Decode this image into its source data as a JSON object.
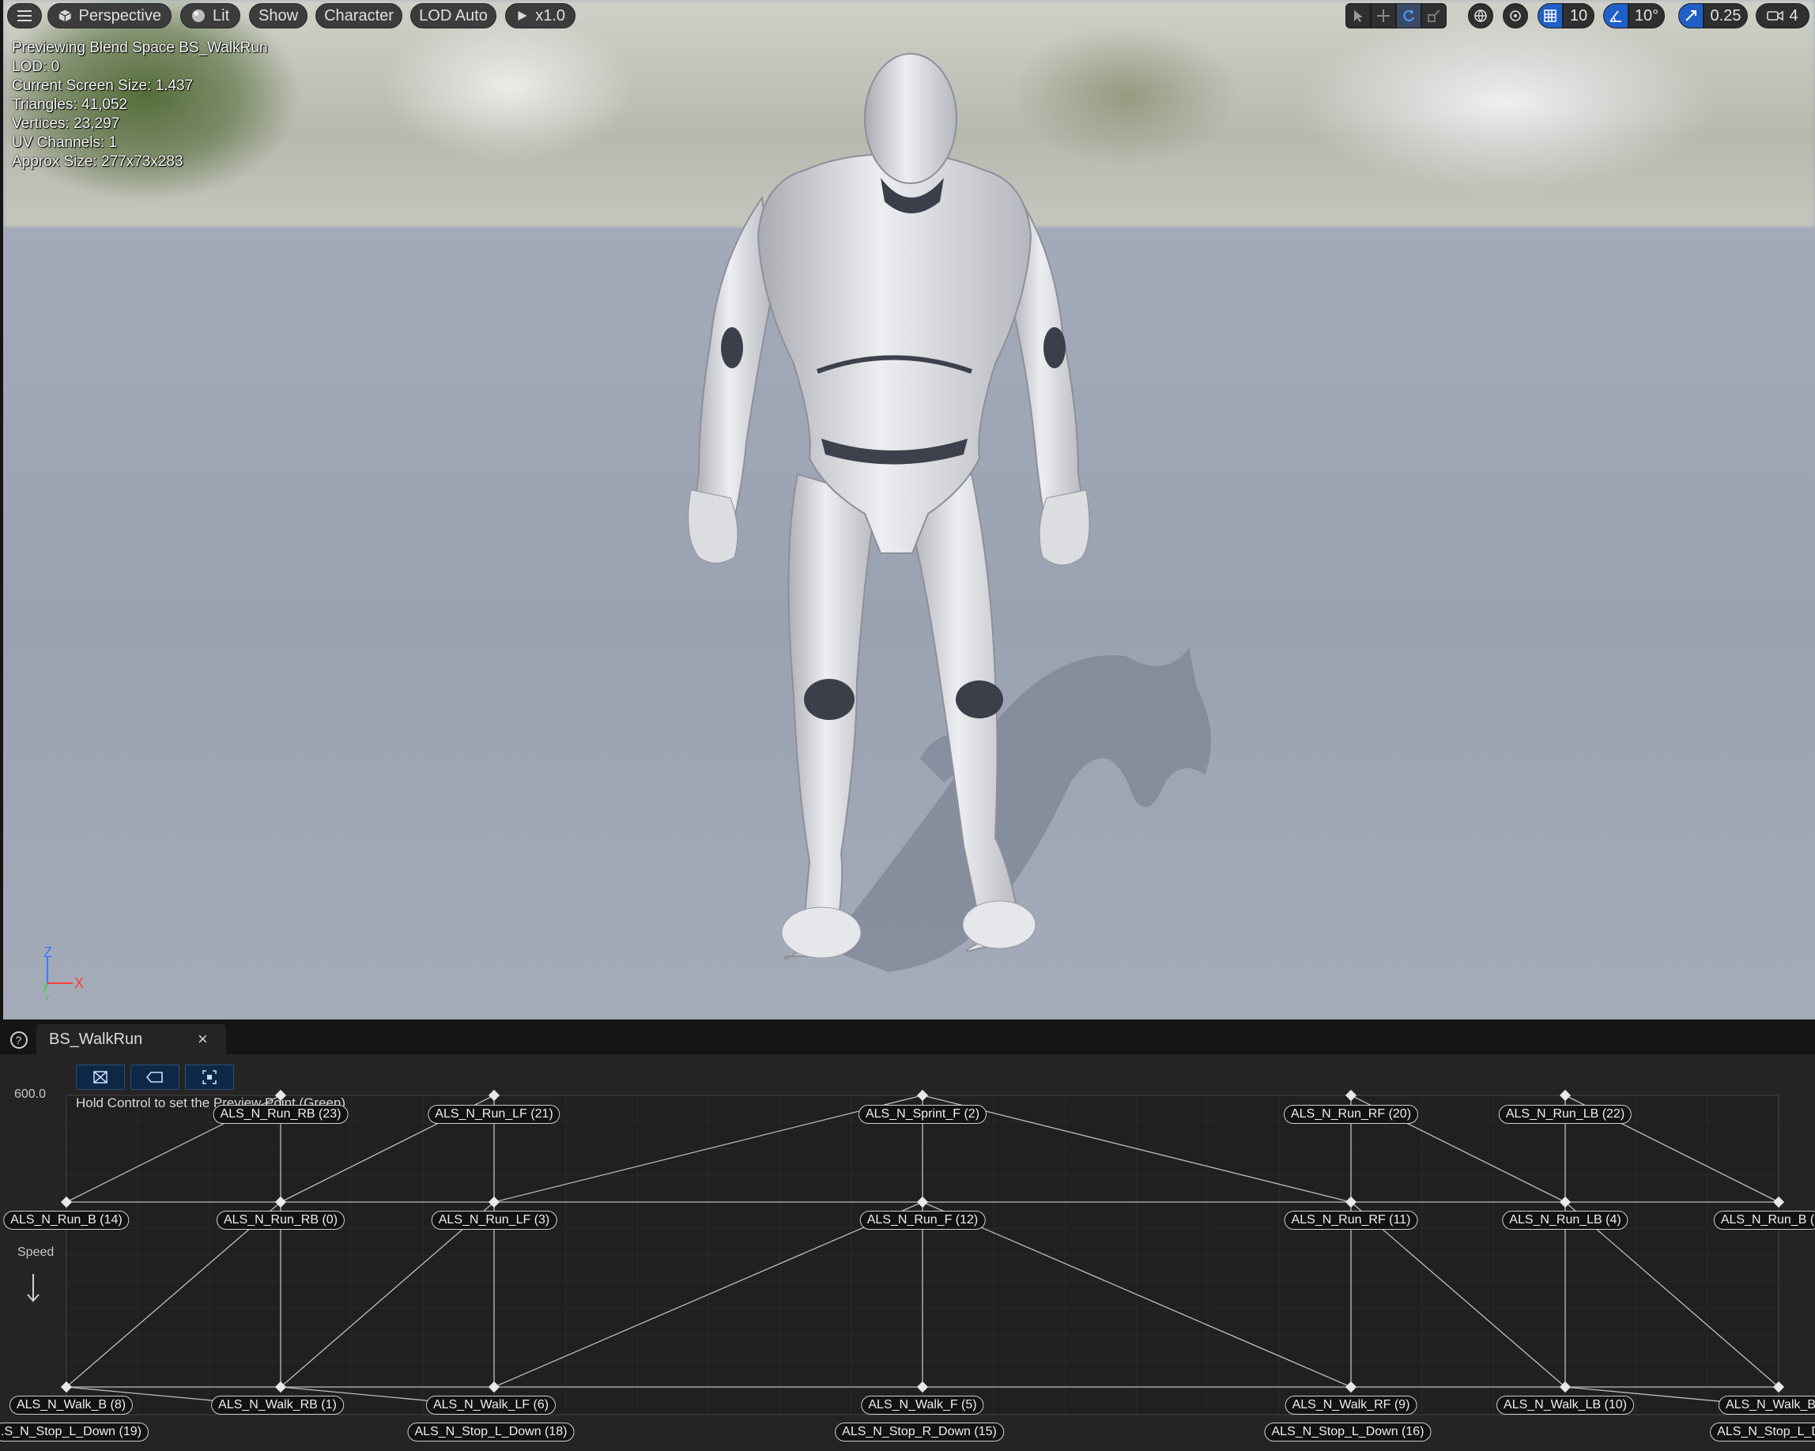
{
  "toolbar": {
    "menu_icon": "hamburger-icon",
    "perspective": "Perspective",
    "lit": "Lit",
    "show": "Show",
    "character": "Character",
    "lod": "LOD Auto",
    "playback": "x1.0",
    "grid_snap": "10",
    "angle_snap": "10°",
    "scale_snap": "0.25",
    "camera_speed": "4"
  },
  "stats": {
    "line1": "Previewing Blend Space BS_WalkRun",
    "line2": "LOD: 0",
    "line3": "Current Screen Size: 1.437",
    "line4": "Triangles: 41,052",
    "line5": "Vertices: 23,297",
    "line6": "UV Channels: 1",
    "line7": "Approx Size: 277x73x283"
  },
  "axis": {
    "z": "Z",
    "x": "X",
    "y": "Y"
  },
  "panel": {
    "tab_title": "BS_WalkRun",
    "close": "×",
    "hint": "Hold Control to set the Preview Point (Green)",
    "y_max": "600.0",
    "y_axis_label": "Speed"
  },
  "samples": [
    {
      "label": "ALS_N_Run_RB (23)"
    },
    {
      "label": "ALS_N_Run_LF (21)"
    },
    {
      "label": "ALS_N_Sprint_F (2)"
    },
    {
      "label": "ALS_N_Run_RF (20)"
    },
    {
      "label": "ALS_N_Run_LB (22)"
    },
    {
      "label": "ALS_N_Run_B (14)"
    },
    {
      "label": "ALS_N_Run_RB (0)"
    },
    {
      "label": "ALS_N_Run_LF (3)"
    },
    {
      "label": "ALS_N_Run_F (12)"
    },
    {
      "label": "ALS_N_Run_RF (11)"
    },
    {
      "label": "ALS_N_Run_LB (4)"
    },
    {
      "label": "ALS_N_Run_B ("
    },
    {
      "label": "ALS_N_Walk_B (8)"
    },
    {
      "label": "ALS_N_Walk_RB (1)"
    },
    {
      "label": "ALS_N_Walk_LF (6)"
    },
    {
      "label": "ALS_N_Walk_F (5)"
    },
    {
      "label": "ALS_N_Walk_RF (9)"
    },
    {
      "label": "ALS_N_Walk_LB (10)"
    },
    {
      "label": "ALS_N_Walk_B"
    },
    {
      "label": ".S_N_Stop_L_Down (19)"
    },
    {
      "label": "ALS_N_Stop_L_Down (18)"
    },
    {
      "label": "ALS_N_Stop_R_Down (15)"
    },
    {
      "label": "ALS_N_Stop_L_Down (16)"
    },
    {
      "label": "ALS_N_Stop_L_Dov"
    }
  ]
}
